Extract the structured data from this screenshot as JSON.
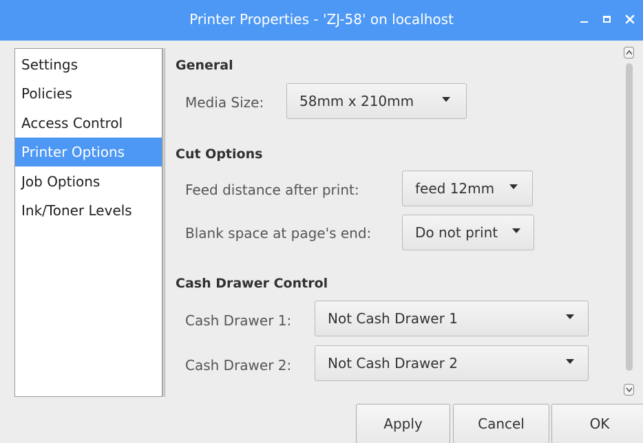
{
  "window": {
    "title": "Printer Properties - 'ZJ-58' on localhost",
    "controls": [
      "minimize-icon",
      "maximize-icon",
      "close-icon"
    ],
    "accent_color": "#4d98f5"
  },
  "sidebar": {
    "items": [
      {
        "label": "Settings"
      },
      {
        "label": "Policies"
      },
      {
        "label": "Access Control"
      },
      {
        "label": "Printer Options"
      },
      {
        "label": "Job Options"
      },
      {
        "label": "Ink/Toner Levels"
      }
    ],
    "selected": "Printer Options"
  },
  "general": {
    "heading": "General",
    "media_size_label": "Media Size:",
    "media_size_value": "58mm x 210mm"
  },
  "cut_options": {
    "heading": "Cut Options",
    "feed_label": "Feed distance after print:",
    "feed_value": "feed 12mm",
    "blank_label": "Blank space at page's end:",
    "blank_value": "Do not print"
  },
  "cash_drawer": {
    "heading": "Cash Drawer Control",
    "drawer1_label": "Cash Drawer 1:",
    "drawer1_value": "Not Cash Drawer 1",
    "drawer2_label": "Cash Drawer 2:",
    "drawer2_value": "Not Cash Drawer 2"
  },
  "buttons": {
    "apply": "Apply",
    "cancel": "Cancel",
    "ok": "OK"
  }
}
